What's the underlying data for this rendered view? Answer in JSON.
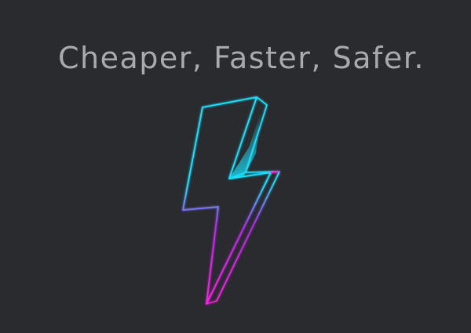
{
  "headline": "Cheaper, Faster, Safer.",
  "icon": "lightning-bolt-icon",
  "colors": {
    "background": "#2a2b2f",
    "text": "#a9aaad",
    "neon_cyan": "#19e3ff",
    "neon_magenta": "#ff1fe6"
  }
}
